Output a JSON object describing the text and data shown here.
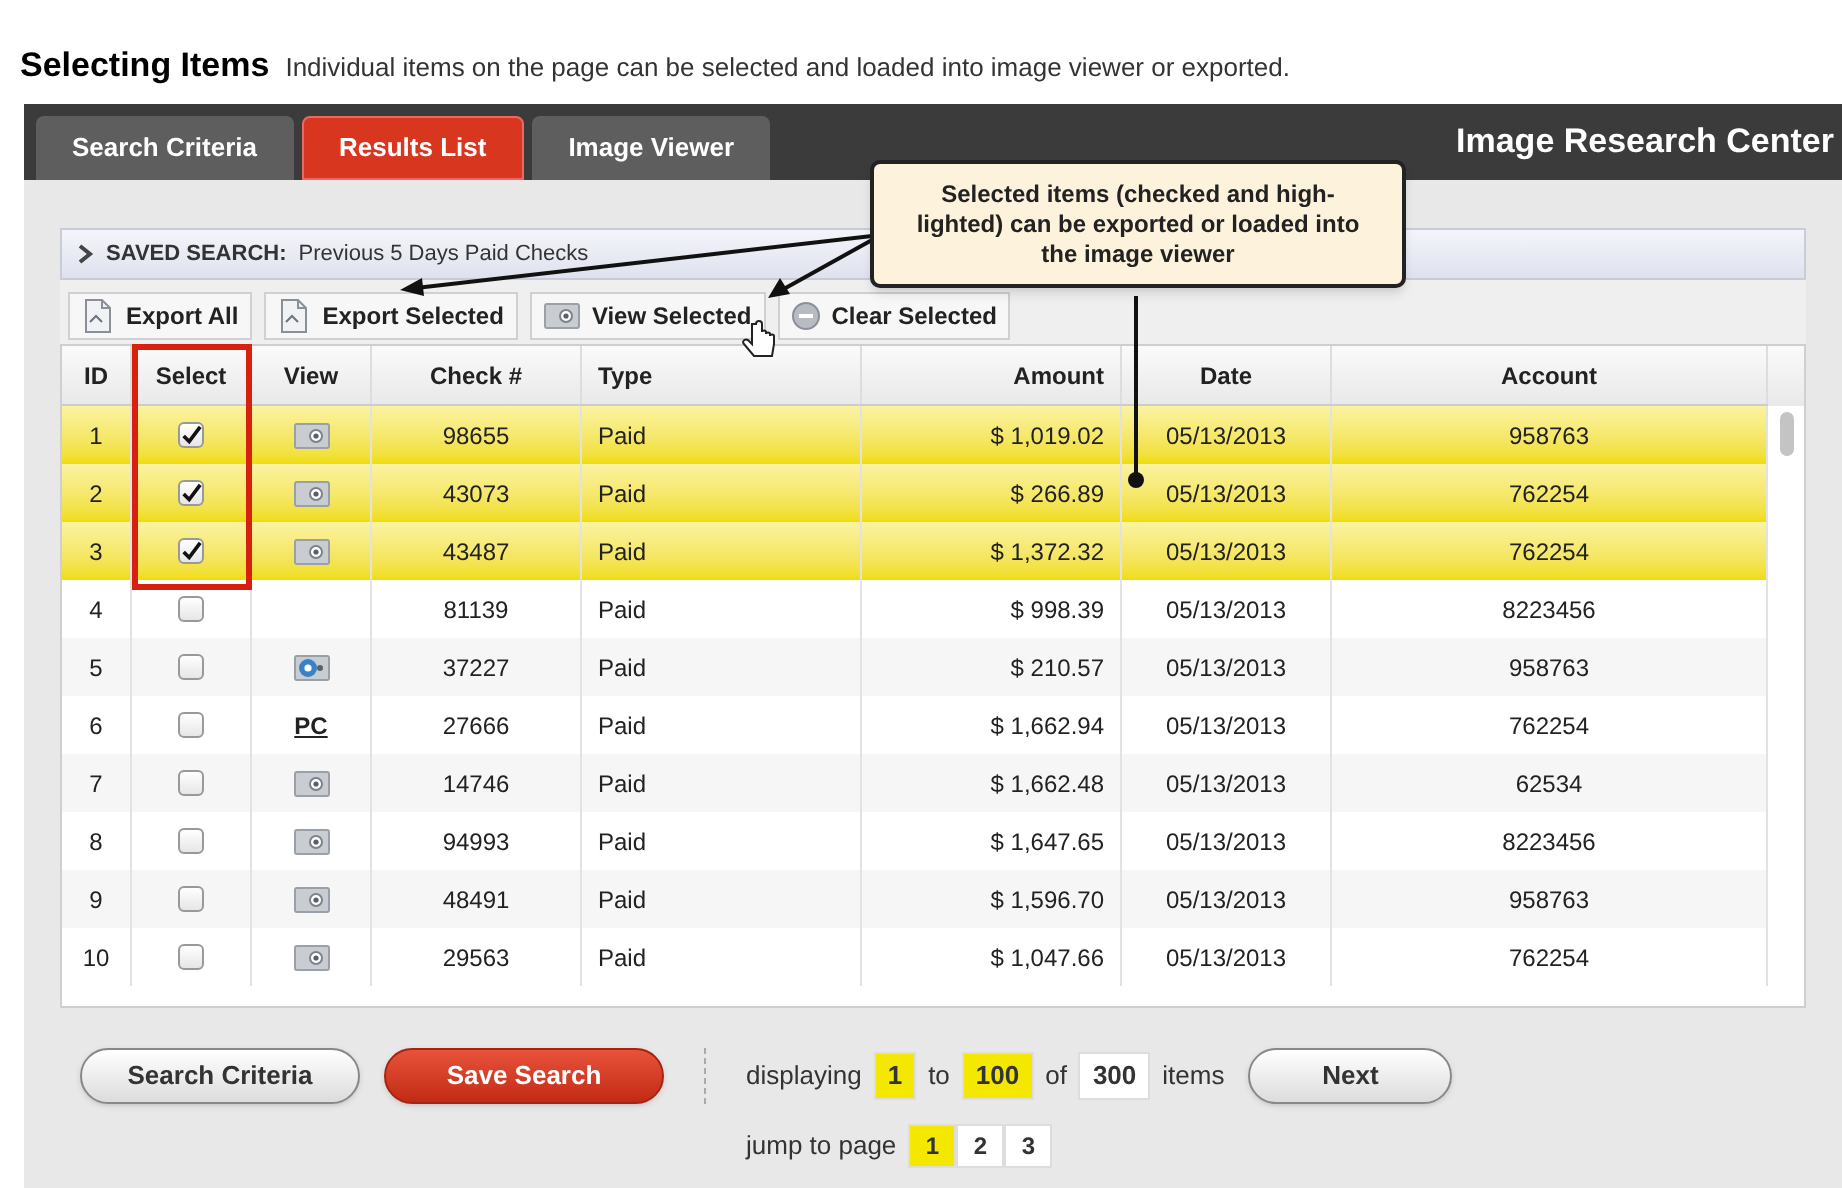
{
  "heading": {
    "title": "Selecting Items",
    "subtitle": "Individual items on the page can be selected and loaded into image viewer or exported."
  },
  "tabs": [
    {
      "label": "Search Criteria",
      "selected": false
    },
    {
      "label": "Results List",
      "selected": true
    },
    {
      "label": "Image Viewer",
      "selected": false
    }
  ],
  "app_title": "Image Research Center",
  "callout": "Selected items (checked and high-lighted) can be exported or loaded into the image viewer",
  "saved_search": {
    "label": "SAVED SEARCH:",
    "value": "Previous 5 Days Paid Checks"
  },
  "toolbar": [
    {
      "label": "Export All",
      "kind": "doc"
    },
    {
      "label": "Export Selected",
      "kind": "doc"
    },
    {
      "label": "View Selected",
      "kind": "camera"
    },
    {
      "label": "Clear Selected",
      "kind": "minus"
    }
  ],
  "table": {
    "columns": [
      "ID",
      "Select",
      "View",
      "Check #",
      "Type",
      "Amount",
      "Date",
      "Account"
    ],
    "rows": [
      {
        "id": "1",
        "checked": true,
        "kind": "camera",
        "check": "98655",
        "type": "Paid",
        "amount": "$ 1,019.02",
        "date": "05/13/2013",
        "account": "958763"
      },
      {
        "id": "2",
        "checked": true,
        "kind": "camera",
        "check": "43073",
        "type": "Paid",
        "amount": "$ 266.89",
        "date": "05/13/2013",
        "account": "762254"
      },
      {
        "id": "3",
        "checked": true,
        "kind": "camera",
        "check": "43487",
        "type": "Paid",
        "amount": "$ 1,372.32",
        "date": "05/13/2013",
        "account": "762254"
      },
      {
        "id": "4",
        "checked": false,
        "kind": "none",
        "check": "81139",
        "type": "Paid",
        "amount": "$ 998.39",
        "date": "05/13/2013",
        "account": "8223456"
      },
      {
        "id": "5",
        "checked": false,
        "kind": "colorcamera",
        "check": "37227",
        "type": "Paid",
        "amount": "$ 210.57",
        "date": "05/13/2013",
        "account": "958763"
      },
      {
        "id": "6",
        "checked": false,
        "kind": "text",
        "view_text": "PC",
        "check": "27666",
        "type": "Paid",
        "amount": "$ 1,662.94",
        "date": "05/13/2013",
        "account": "762254"
      },
      {
        "id": "7",
        "checked": false,
        "kind": "camera",
        "check": "14746",
        "type": "Paid",
        "amount": "$ 1,662.48",
        "date": "05/13/2013",
        "account": "62534"
      },
      {
        "id": "8",
        "checked": false,
        "kind": "camera",
        "check": "94993",
        "type": "Paid",
        "amount": "$ 1,647.65",
        "date": "05/13/2013",
        "account": "8223456"
      },
      {
        "id": "9",
        "checked": false,
        "kind": "camera",
        "check": "48491",
        "type": "Paid",
        "amount": "$ 1,596.70",
        "date": "05/13/2013",
        "account": "958763"
      },
      {
        "id": "10",
        "checked": false,
        "kind": "camera",
        "check": "29563",
        "type": "Paid",
        "amount": "$ 1,047.66",
        "date": "05/13/2013",
        "account": "762254"
      }
    ]
  },
  "footer_buttons": [
    {
      "label": "Search Criteria",
      "kind": "plain"
    },
    {
      "label": "Save Search",
      "kind": "primary"
    }
  ],
  "pagination": {
    "displaying": "displaying",
    "from": "1",
    "to_label": "to",
    "to": "100",
    "of_label": "of",
    "total": "300",
    "items": "items",
    "next": "Next",
    "jump_label": "jump to page",
    "pages": [
      {
        "label": "1",
        "selected": true
      },
      {
        "label": "2",
        "selected": false
      },
      {
        "label": "3",
        "selected": false
      }
    ]
  }
}
